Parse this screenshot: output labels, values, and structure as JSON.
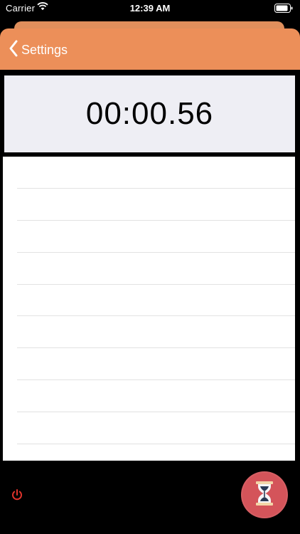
{
  "status_bar": {
    "carrier": "Carrier",
    "time": "12:39 AM",
    "icons": [
      "wifi-icon",
      "battery-icon"
    ]
  },
  "nav": {
    "back_label": "Settings",
    "back_icon": "chevron-left-icon"
  },
  "timer": {
    "display": "00:00.56"
  },
  "laps": {
    "rows": []
  },
  "controls": {
    "power_icon": "power-icon",
    "start_icon": "hourglass-icon"
  },
  "colors": {
    "nav_accent": "#ec8f59",
    "start_button": "#d4545a",
    "power_icon": "#e0332b",
    "timer_panel_bg": "#eeeef4"
  }
}
